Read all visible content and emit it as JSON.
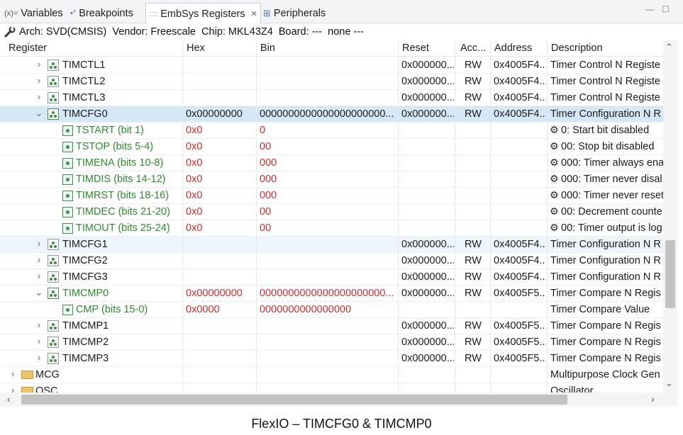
{
  "tabs": [
    {
      "icon": "(x)=",
      "label": "Variables"
    },
    {
      "icon": "•°",
      "label": "Breakpoints"
    },
    {
      "icon": "::::",
      "label": "EmbSys Registers",
      "close": "✕"
    },
    {
      "icon": "⊞",
      "label": "Peripherals"
    }
  ],
  "window_controls": {
    "minimize": "—",
    "maximize": "☐"
  },
  "info": "Arch: SVD(CMSIS)  Vendor: Freescale  Chip: MKL43Z4  Board: ---  none ---",
  "columns": [
    "Register",
    "Hex",
    "Bin",
    "Reset",
    "Acc...",
    "Address",
    "Description"
  ],
  "rows": [
    {
      "kind": "reg",
      "chev": "›",
      "name": "TIMCTL1",
      "hex": "",
      "bin": "",
      "reset": "0x000000...",
      "acc": "RW",
      "addr": "0x4005F4...",
      "desc": "Timer Control N Registe"
    },
    {
      "kind": "reg",
      "chev": "›",
      "name": "TIMCTL2",
      "hex": "",
      "bin": "",
      "reset": "0x000000...",
      "acc": "RW",
      "addr": "0x4005F4...",
      "desc": "Timer Control N Registe"
    },
    {
      "kind": "reg",
      "chev": "›",
      "name": "TIMCTL3",
      "hex": "",
      "bin": "",
      "reset": "0x000000...",
      "acc": "RW",
      "addr": "0x4005F4...",
      "desc": "Timer Control N Registe"
    },
    {
      "kind": "reg-open",
      "chev": "⌄",
      "name": "TIMCFG0",
      "hex": "0x00000000",
      "bin": "0000000000000000000000...",
      "reset": "0x000000...",
      "acc": "RW",
      "addr": "0x4005F4...",
      "desc": "Timer Configuration N R"
    },
    {
      "kind": "field",
      "name": "TSTART (bit 1)",
      "hex": "0x0",
      "bin": "0",
      "desc": "0: Start bit disabled"
    },
    {
      "kind": "field",
      "name": "TSTOP (bits 5-4)",
      "hex": "0x0",
      "bin": "00",
      "desc": "00: Stop bit disabled"
    },
    {
      "kind": "field",
      "name": "TIMENA (bits 10-8)",
      "hex": "0x0",
      "bin": "000",
      "desc": "000: Timer always ena"
    },
    {
      "kind": "field",
      "name": "TIMDIS (bits 14-12)",
      "hex": "0x0",
      "bin": "000",
      "desc": "000: Timer never disal"
    },
    {
      "kind": "field",
      "name": "TIMRST (bits 18-16)",
      "hex": "0x0",
      "bin": "000",
      "desc": "000: Timer never reset"
    },
    {
      "kind": "field",
      "name": "TIMDEC (bits 21-20)",
      "hex": "0x0",
      "bin": "00",
      "desc": "00: Decrement counte"
    },
    {
      "kind": "field",
      "name": "TIMOUT (bits 25-24)",
      "hex": "0x0",
      "bin": "00",
      "desc": "00: Timer output is log"
    },
    {
      "kind": "reg",
      "chev": "›",
      "name": "TIMCFG1",
      "hex": "",
      "bin": "",
      "reset": "0x000000...",
      "acc": "RW",
      "addr": "0x4005F4...",
      "desc": "Timer Configuration N R"
    },
    {
      "kind": "reg",
      "chev": "›",
      "name": "TIMCFG2",
      "hex": "",
      "bin": "",
      "reset": "0x000000...",
      "acc": "RW",
      "addr": "0x4005F4...",
      "desc": "Timer Configuration N R"
    },
    {
      "kind": "reg",
      "chev": "›",
      "name": "TIMCFG3",
      "hex": "",
      "bin": "",
      "reset": "0x000000...",
      "acc": "RW",
      "addr": "0x4005F4...",
      "desc": "Timer Configuration N R"
    },
    {
      "kind": "reg-mod",
      "chev": "⌄",
      "name": "TIMCMP0",
      "hex": "0x00000000",
      "bin": "0000000000000000000000...",
      "reset": "0x000000...",
      "acc": "RW",
      "addr": "0x4005F5...",
      "desc": "Timer Compare N Regis"
    },
    {
      "kind": "field-plain",
      "name": "CMP (bits 15-0)",
      "hex": "0x0000",
      "bin": "0000000000000000",
      "desc": "Timer Compare Value"
    },
    {
      "kind": "reg",
      "chev": "›",
      "name": "TIMCMP1",
      "hex": "",
      "bin": "",
      "reset": "0x000000...",
      "acc": "RW",
      "addr": "0x4005F5...",
      "desc": "Timer Compare N Regis"
    },
    {
      "kind": "reg",
      "chev": "›",
      "name": "TIMCMP2",
      "hex": "",
      "bin": "",
      "reset": "0x000000...",
      "acc": "RW",
      "addr": "0x4005F5...",
      "desc": "Timer Compare N Regis"
    },
    {
      "kind": "reg",
      "chev": "›",
      "name": "TIMCMP3",
      "hex": "",
      "bin": "",
      "reset": "0x000000...",
      "acc": "RW",
      "addr": "0x4005F5...",
      "desc": "Timer Compare N Regis"
    },
    {
      "kind": "periph",
      "chev": "›",
      "name": "MCG",
      "hex": "",
      "bin": "",
      "reset": "",
      "acc": "",
      "addr": "",
      "desc": "Multipurpose Clock Gen"
    },
    {
      "kind": "periph",
      "chev": "›",
      "name": "OSC",
      "hex": "",
      "bin": "",
      "reset": "",
      "acc": "",
      "addr": "",
      "desc": "Oscillator"
    }
  ],
  "scroll": {
    "up": "⌃",
    "down": "⌄",
    "left": "‹",
    "right": "›"
  },
  "caption": "FlexIO – TIMCFG0  &  TIMCMP0",
  "colors": {
    "selected_row": "#d6e8f7",
    "field_name": "#2e8b2e",
    "field_value": "#d22b2b"
  }
}
